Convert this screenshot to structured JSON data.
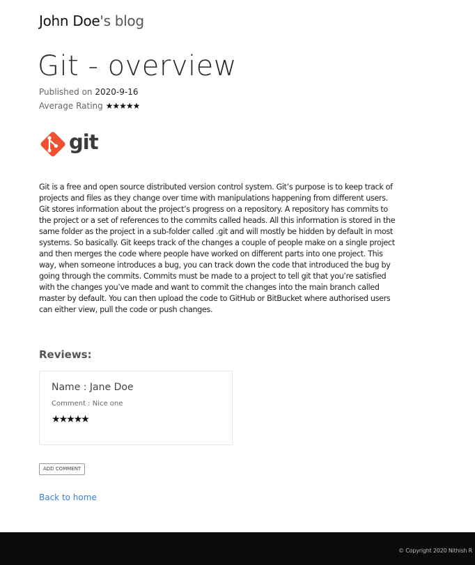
{
  "header": {
    "brand_name": "John Doe",
    "brand_suffix": "'s blog"
  },
  "post": {
    "title": "Git - overview",
    "published_label": "Published on",
    "published_date": "2020-9-16",
    "rating_label": "Average Rating",
    "average_rating": 5,
    "image_alt": "git",
    "body": "Git is a free and open source distributed version control system. Git’s purpose is to keep track of projects and files as they change over time with manipulations happening from different users. Git stores information about the project’s progress on a repository. A repository has commits to the project or a set of references to the commits called heads. All this information is stored in the same folder as the project in a sub-folder called .git and will mostly be hidden by default in most systems. So basically. Git keeps track of the changes a couple of people make on a single project and then merges the code where people have worked on different parts into one project. This way, when someone introduces a bug, you can track down the code that introduced the bug by going through the commits. Commits must be made to a project to tell git that you’re satisfied with the changes you’ve made and want to commit the changes into the main branch called master by default. You can then upload the code to GitHub or BitBucket where authorised users can either view, pull the code or push changes."
  },
  "reviews": {
    "heading": "Reviews:",
    "items": [
      {
        "name": "Name : Jane Doe",
        "comment": "Comment : Nice one",
        "rating": 5
      }
    ]
  },
  "actions": {
    "add_comment_label": "ADD COMMENT",
    "back_label": "Back to home"
  },
  "footer": {
    "copyright": "© Copyright 2020 Nithish R"
  },
  "colors": {
    "link": "#3a7fd8",
    "git_logo": "#f05133",
    "footer_bg": "#0b0b0b"
  },
  "icons": {
    "rating_star": "star-icon",
    "logo": "git-logo-icon"
  }
}
